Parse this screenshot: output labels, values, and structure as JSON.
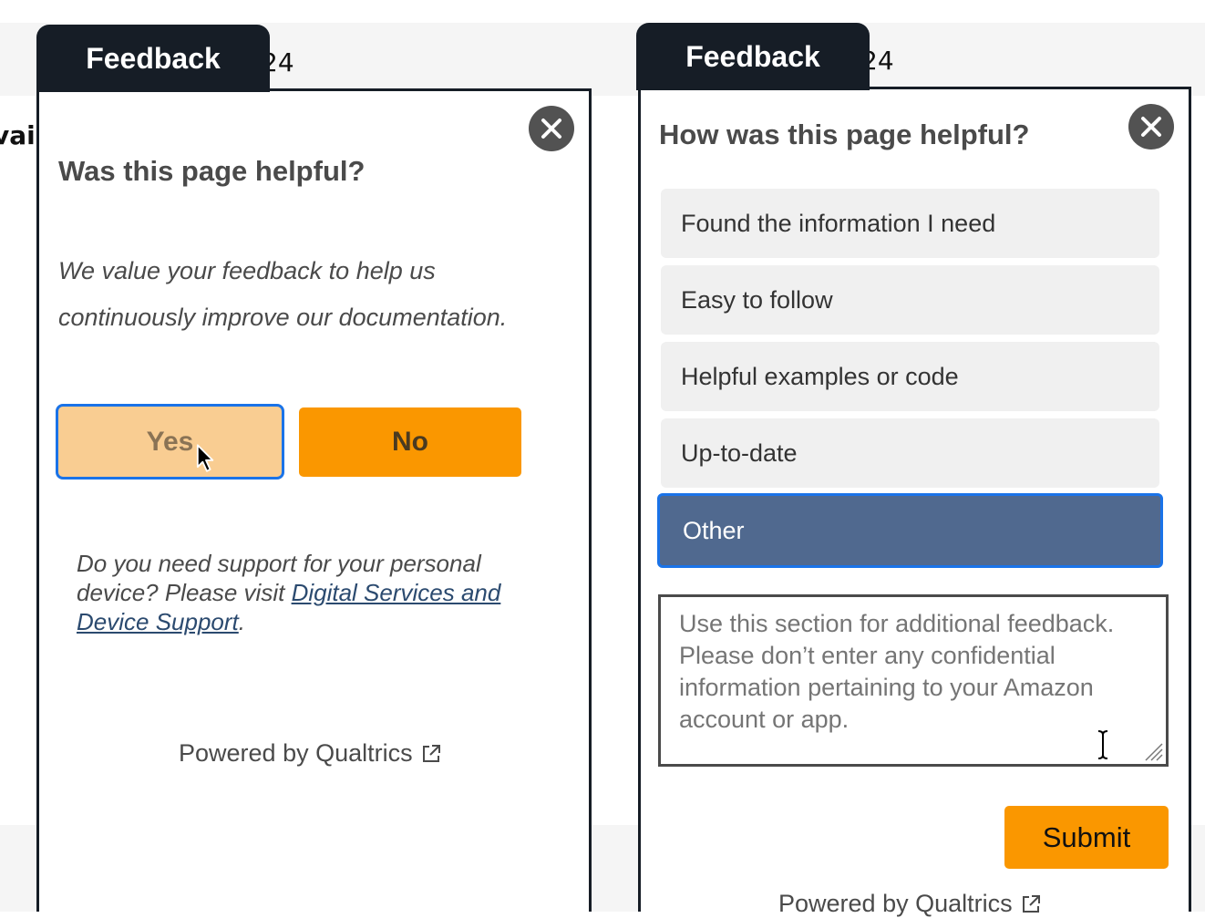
{
  "background": {
    "left_fragment": "vail",
    "tab_fragment_left": "24",
    "tab_fragment_right": "24"
  },
  "left_panel": {
    "tab_label": "Feedback",
    "close_icon": "close-icon",
    "question": "Was this page helpful?",
    "intro_line1": "We value your feedback to help us",
    "intro_line2": "continuously improve our documentation.",
    "yes_label": "Yes",
    "no_label": "No",
    "support_text_line1": "Do you need support for your personal",
    "support_text_line2_prefix": "device? Please visit ",
    "support_link_part1": "Digital Services and",
    "support_link_part2": "Device Support",
    "support_text_suffix": ".",
    "powered_by": "Powered by Qualtrics"
  },
  "right_panel": {
    "tab_label": "Feedback",
    "close_icon": "close-icon",
    "question": "How was this page helpful?",
    "options": [
      {
        "label": "Found the information I need",
        "selected": false
      },
      {
        "label": "Easy to follow",
        "selected": false
      },
      {
        "label": "Helpful examples or code",
        "selected": false
      },
      {
        "label": "Up-to-date",
        "selected": false
      },
      {
        "label": "Other",
        "selected": true
      }
    ],
    "textarea_placeholder": "Use this section for additional feedback. Please don’t enter any confidential information pertaining to your Amazon account or app.",
    "textarea_value": "",
    "submit_label": "Submit",
    "powered_by": "Powered by Qualtrics"
  },
  "colors": {
    "tab_bg": "#161d26",
    "accent_orange": "#fa9700",
    "yes_bg": "#f9cd92",
    "selected_option_bg": "#50698f",
    "focus_blue": "#1a73e8"
  }
}
